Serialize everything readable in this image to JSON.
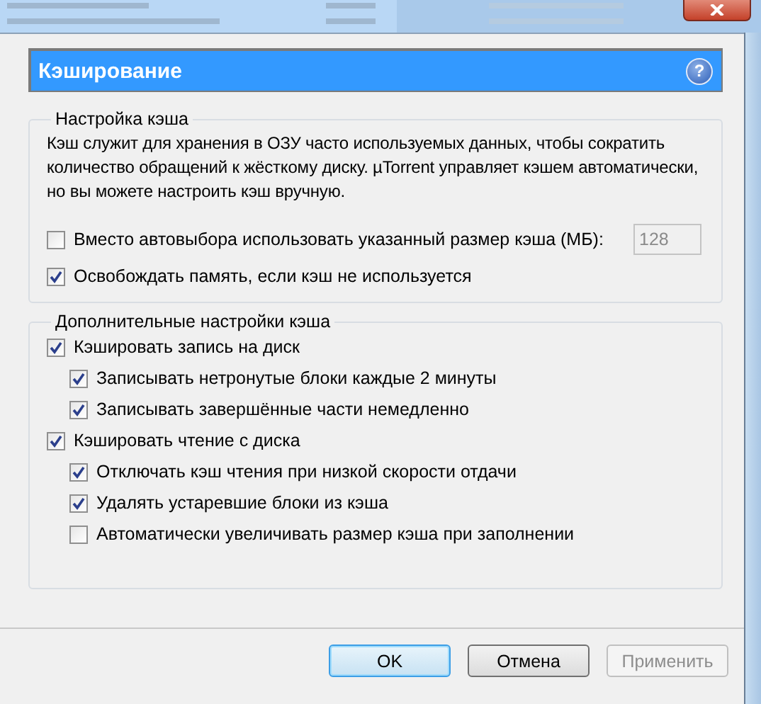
{
  "header": {
    "title": "Кэширование",
    "help": "?"
  },
  "cache_settings": {
    "title": "Настройка кэша",
    "description": "Кэш служит для хранения в ОЗУ часто используемых данных, чтобы сократить количество обращений к жёсткому диску. µTorrent управляет кэшем автоматически, но вы можете настроить кэш вручную.",
    "options": [
      {
        "label": "Вместо автовыбора использовать указанный размер кэша (МБ):",
        "checked": false,
        "field": {
          "value": "128",
          "disabled": true
        }
      },
      {
        "label": "Освобождать память, если кэш не используется",
        "checked": true
      }
    ]
  },
  "advanced": {
    "title": "Дополнительные настройки кэша",
    "options": [
      {
        "label": "Кэшировать запись на диск",
        "checked": true,
        "children": [
          {
            "label": "Записывать нетронутые блоки каждые 2 минуты",
            "checked": true
          },
          {
            "label": "Записывать завершённые части немедленно",
            "checked": true
          }
        ]
      },
      {
        "label": "Кэшировать чтение с диска",
        "checked": true,
        "children": [
          {
            "label": "Отключать кэш чтения при низкой скорости отдачи",
            "checked": true
          },
          {
            "label": "Удалять устаревшие блоки из кэша",
            "checked": true
          },
          {
            "label": "Автоматически увеличивать размер кэша при заполнении",
            "checked": false
          }
        ]
      }
    ]
  },
  "buttons": [
    {
      "label": "OK",
      "default": true,
      "disabled": false
    },
    {
      "label": "Отмена",
      "default": false,
      "disabled": false
    },
    {
      "label": "Применить",
      "default": false,
      "disabled": true
    }
  ]
}
